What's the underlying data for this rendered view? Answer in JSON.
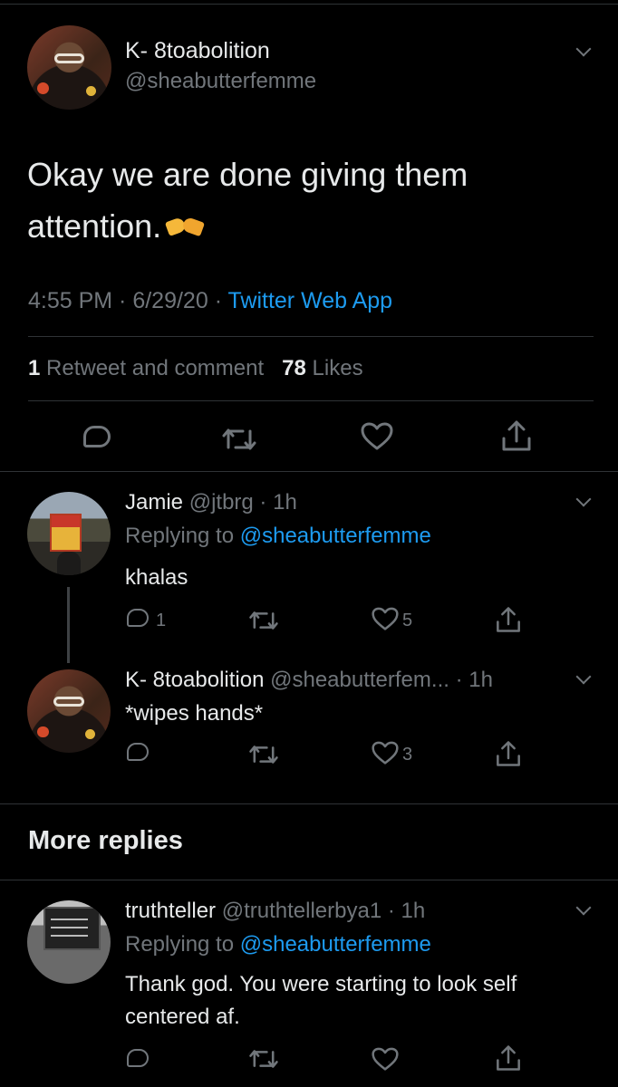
{
  "main_tweet": {
    "author_name": "K- 8toabolition",
    "author_handle": "@sheabutterfemme",
    "text": "Okay we are done giving them attention.",
    "emoji": "handshake-emoji",
    "time": "4:55 PM",
    "date": "6/29/20",
    "source": "Twitter Web App",
    "retweet_count": "1",
    "retweet_label": "Retweet and comment",
    "likes_count": "78",
    "likes_label": "Likes"
  },
  "replies": [
    {
      "name": "Jamie",
      "handle": "@jtbrg",
      "age": "1h",
      "replying_to_label": "Replying to",
      "replying_to": "@sheabutterfemme",
      "text": "khalas",
      "reply_count": "1",
      "like_count": "5"
    },
    {
      "name": "K- 8toabolition",
      "handle": "@sheabutterfem...",
      "age": "1h",
      "text": "*wipes hands*",
      "like_count": "3"
    }
  ],
  "more_replies": {
    "heading": "More replies",
    "items": [
      {
        "name": "truthteller",
        "handle": "@truthtellerbya1",
        "age": "1h",
        "replying_to_label": "Replying to",
        "replying_to": "@sheabutterfemme",
        "text": "Thank god. You were starting to look self centered af."
      }
    ]
  },
  "colors": {
    "background": "#000000",
    "text": "#e7e9ea",
    "muted": "#71767b",
    "accent": "#1d9bf0",
    "divider": "#2f3336"
  }
}
